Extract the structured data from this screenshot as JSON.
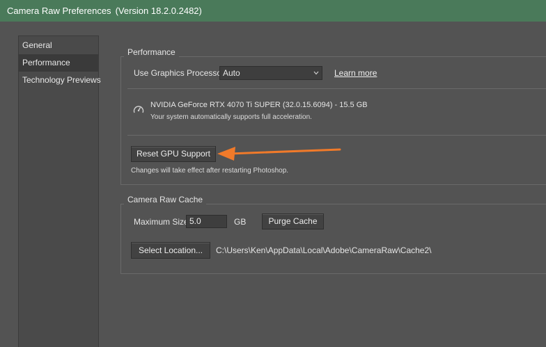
{
  "window": {
    "title": "Camera Raw Preferences",
    "version": "(Version 18.2.0.2482)"
  },
  "sidebar": {
    "items": [
      {
        "label": "General"
      },
      {
        "label": "Performance"
      },
      {
        "label": "Technology Previews"
      }
    ],
    "selected": "Performance"
  },
  "performance": {
    "title": "Performance",
    "gpu_label": "Use Graphics Processor:",
    "gpu_value": "Auto",
    "learn_more": "Learn more",
    "gpu_name": "NVIDIA GeForce RTX 4070 Ti SUPER (32.0.15.6094) - 15.5 GB",
    "gpu_status": "Your system automatically supports full acceleration.",
    "status_icon": "speedometer-icon",
    "reset_button": "Reset GPU Support",
    "reset_note": "Changes will take effect after restarting Photoshop."
  },
  "cache": {
    "title": "Camera Raw Cache",
    "max_size_label": "Maximum Size:",
    "max_size_value": "5.0",
    "unit": "GB",
    "purge_button": "Purge Cache",
    "location_button": "Select Location...",
    "location_path": "C:\\Users\\Ken\\AppData\\Local\\Adobe\\CameraRaw\\Cache2\\"
  },
  "annotation": {
    "arrow_color": "#f07a2a"
  },
  "colors": {
    "titlebar": "#4a7a5a",
    "background": "#535353",
    "sidebar": "#4a4a4a",
    "sidebar_selected": "#3a3a3a"
  }
}
